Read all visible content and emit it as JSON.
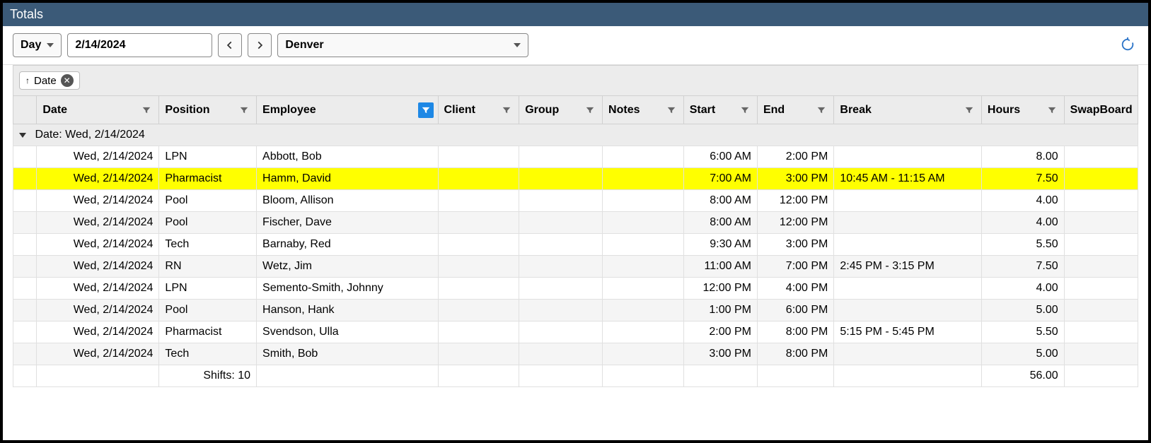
{
  "window": {
    "title": "Totals"
  },
  "toolbar": {
    "view_mode": "Day",
    "date": "2/14/2024",
    "location": "Denver"
  },
  "grouping": {
    "chip_label": "Date"
  },
  "columns": {
    "date": "Date",
    "position": "Position",
    "employee": "Employee",
    "client": "Client",
    "group": "Group",
    "notes": "Notes",
    "start": "Start",
    "end": "End",
    "break": "Break",
    "hours": "Hours",
    "swapboard": "SwapBoard"
  },
  "group_header": "Date: Wed, 2/14/2024",
  "rows": [
    {
      "date": "Wed, 2/14/2024",
      "position": "LPN",
      "employee": "Abbott, Bob",
      "client": "",
      "group": "",
      "notes": "",
      "start": "6:00 AM",
      "end": "2:00 PM",
      "break": "",
      "hours": "8.00",
      "swap": "",
      "hl": false
    },
    {
      "date": "Wed, 2/14/2024",
      "position": "Pharmacist",
      "employee": "Hamm, David",
      "client": "",
      "group": "",
      "notes": "",
      "start": "7:00 AM",
      "end": "3:00 PM",
      "break": "10:45 AM - 11:15 AM",
      "hours": "7.50",
      "swap": "",
      "hl": true
    },
    {
      "date": "Wed, 2/14/2024",
      "position": "Pool",
      "employee": "Bloom, Allison",
      "client": "",
      "group": "",
      "notes": "",
      "start": "8:00 AM",
      "end": "12:00 PM",
      "break": "",
      "hours": "4.00",
      "swap": "",
      "hl": false
    },
    {
      "date": "Wed, 2/14/2024",
      "position": "Pool",
      "employee": "Fischer, Dave",
      "client": "",
      "group": "",
      "notes": "",
      "start": "8:00 AM",
      "end": "12:00 PM",
      "break": "",
      "hours": "4.00",
      "swap": "",
      "hl": false
    },
    {
      "date": "Wed, 2/14/2024",
      "position": "Tech",
      "employee": "Barnaby, Red",
      "client": "",
      "group": "",
      "notes": "",
      "start": "9:30 AM",
      "end": "3:00 PM",
      "break": "",
      "hours": "5.50",
      "swap": "",
      "hl": false
    },
    {
      "date": "Wed, 2/14/2024",
      "position": "RN",
      "employee": "Wetz, Jim",
      "client": "",
      "group": "",
      "notes": "",
      "start": "11:00 AM",
      "end": "7:00 PM",
      "break": "2:45 PM - 3:15 PM",
      "hours": "7.50",
      "swap": "",
      "hl": false
    },
    {
      "date": "Wed, 2/14/2024",
      "position": "LPN",
      "employee": "Semento-Smith, Johnny",
      "client": "",
      "group": "",
      "notes": "",
      "start": "12:00 PM",
      "end": "4:00 PM",
      "break": "",
      "hours": "4.00",
      "swap": "",
      "hl": false
    },
    {
      "date": "Wed, 2/14/2024",
      "position": "Pool",
      "employee": "Hanson, Hank",
      "client": "",
      "group": "",
      "notes": "",
      "start": "1:00 PM",
      "end": "6:00 PM",
      "break": "",
      "hours": "5.00",
      "swap": "",
      "hl": false
    },
    {
      "date": "Wed, 2/14/2024",
      "position": "Pharmacist",
      "employee": "Svendson, Ulla",
      "client": "",
      "group": "",
      "notes": "",
      "start": "2:00 PM",
      "end": "8:00 PM",
      "break": "5:15 PM - 5:45 PM",
      "hours": "5.50",
      "swap": "",
      "hl": false
    },
    {
      "date": "Wed, 2/14/2024",
      "position": "Tech",
      "employee": "Smith, Bob",
      "client": "",
      "group": "",
      "notes": "",
      "start": "3:00 PM",
      "end": "8:00 PM",
      "break": "",
      "hours": "5.00",
      "swap": "",
      "hl": false
    }
  ],
  "footer": {
    "shifts_label": "Shifts: 10",
    "total_hours": "56.00"
  }
}
